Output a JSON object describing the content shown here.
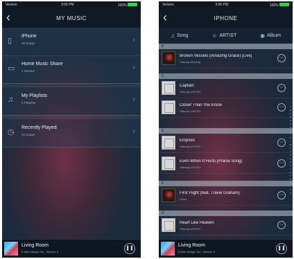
{
  "status": {
    "carrier": "Verizon",
    "time": "3:56 PM",
    "battery": "100%"
  },
  "left": {
    "title": "MY MUSIC",
    "items": [
      {
        "label": "iPhone",
        "sub": "10 Songs",
        "icon": "phone-icon"
      },
      {
        "label": "Home Music Share",
        "sub": "1 Servers",
        "icon": "router-icon"
      },
      {
        "label": "My Playlists",
        "sub": "5 Playlists",
        "icon": "playlist-icon"
      },
      {
        "label": "Recently Played",
        "sub": "10 Songs",
        "icon": "history-icon"
      }
    ]
  },
  "right": {
    "title": "IPHONE",
    "tabs": [
      {
        "label": "Song",
        "icon": "music-note-icon"
      },
      {
        "label": "ARTIST",
        "icon": "artist-icon"
      },
      {
        "label": "Album",
        "icon": "album-icon"
      }
    ],
    "sections": [
      {
        "letter": "B",
        "songs": [
          {
            "title": "Broken Vessels (Amazing Grace) [Live]",
            "artist": "Hillsong Worship",
            "art": "photo"
          }
        ]
      },
      {
        "letter": "C",
        "songs": [
          {
            "title": "Captain",
            "artist": "Hillsong UNITED",
            "art": "blank"
          },
          {
            "title": "Closer Than You Know",
            "artist": "Hillsong UNITED",
            "art": "blank"
          }
        ]
      },
      {
        "letter": "E",
        "songs": [
          {
            "title": "Empires",
            "artist": "Hillsong UNITED",
            "art": "blank"
          },
          {
            "title": "Even When It Hurts (Praise Song)",
            "artist": "Hillsong UNITED",
            "art": "blank"
          }
        ]
      },
      {
        "letter": "F",
        "songs": [
          {
            "title": "First Flight (feat. Travie Graham)",
            "artist": "Owen",
            "art": "dark"
          }
        ]
      },
      {
        "letter": "H",
        "songs": [
          {
            "title": "Heart Like Heaven",
            "artist": "Hillsong UNITED",
            "art": "blank"
          }
        ]
      }
    ],
    "index_letters": "A B C D E F G H I J K L M N O P Q R S T U V W X Y Z #"
  },
  "player": {
    "room": "Living Room",
    "track": "It Was Always You - Maroon 5"
  }
}
